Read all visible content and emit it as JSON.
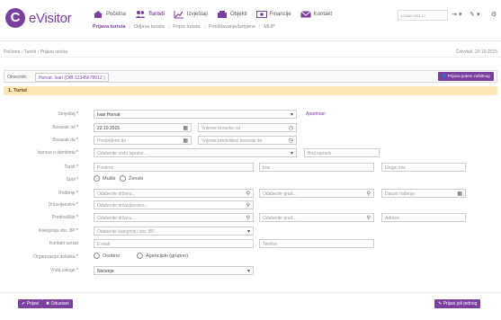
{
  "app": {
    "logo_letter": "C",
    "logo_text": "eVisitor",
    "brand_color": "#7b3fa0"
  },
  "nav": [
    {
      "label": "Početna",
      "icon": "house-icon"
    },
    {
      "label": "Turisti",
      "icon": "users-icon"
    },
    {
      "label": "Izvještaji",
      "icon": "chart-icon"
    },
    {
      "label": "Objekti",
      "icon": "building-icon"
    },
    {
      "label": "Financije",
      "icon": "money-icon"
    },
    {
      "label": "Kontakt",
      "icon": "mail-icon"
    }
  ],
  "subnav": [
    "Prijava turista",
    "Odjava turista",
    "Popis turista",
    "Poništavanje/ismjene",
    "MUP"
  ],
  "user": {
    "account": "1234567890 12",
    "arrow": "▾"
  },
  "breadcrumb": "Početna › Turisti › Prijava turista",
  "date": "Četvrtak, 20.10.2015",
  "record": {
    "label": "Obveznik:",
    "name": "Horvat, Ivan (OIB:12345678912 )",
    "button": "Prijava putem zaštitnog"
  },
  "section_title": "1. Turist",
  "form": {
    "objekt": {
      "label": "Smještaj",
      "value": "Ivan Horvat",
      "extra": "Apartman"
    },
    "boravak_od": {
      "label": "Boravak od",
      "value": "22.10.2015",
      "time": "Vrijeme boravka od"
    },
    "boravak_do": {
      "label": "Boravak do",
      "value": "Predviđeno do",
      "time": "Vrijeme predviđeni boravak do"
    },
    "isprava": {
      "label": "Isprava o identitetu",
      "value": "Odaberite vrstu isprave...",
      "broj": "Broj isprave"
    },
    "turist": {
      "label": "Turist",
      "prezime": "Prezime",
      "ime": "Ime",
      "drugo_ime": "Drugo ime"
    },
    "spol": {
      "label": "Spol",
      "m": "Muški",
      "z": "Ženski"
    },
    "rodjenje": {
      "label": "Rođenje",
      "drzava": "Odaberite državu...",
      "grad": "Odaberite grad...",
      "datum": "Datum rođenja"
    },
    "drzavljanstvo": {
      "label": "Državljanstvo",
      "value": "Odaberite državljanstvo..."
    },
    "prebivaliste": {
      "label": "Prebivalište",
      "drzava": "Odaberite državu...",
      "grad": "Odaberite grad...",
      "adresa": "Adresa"
    },
    "kategorija": {
      "label": "Kategorija obv. BP",
      "value": "Odaberite kategoriju obv. BP..."
    },
    "kontakt": {
      "label": "Kontakt turista",
      "email": "E-mail",
      "telefon": "Telefon"
    },
    "organizacija": {
      "label": "Organizacija dolaska",
      "osobno": "Osobno",
      "agencija": "Agencijski (grupno)"
    },
    "usluga": {
      "label": "Vrsta usluge",
      "value": "Noćenje"
    }
  },
  "footer": {
    "prijava": "Prijavi",
    "odustani": "Odustani",
    "prijavi_jos": "Prijavi još jednog"
  }
}
